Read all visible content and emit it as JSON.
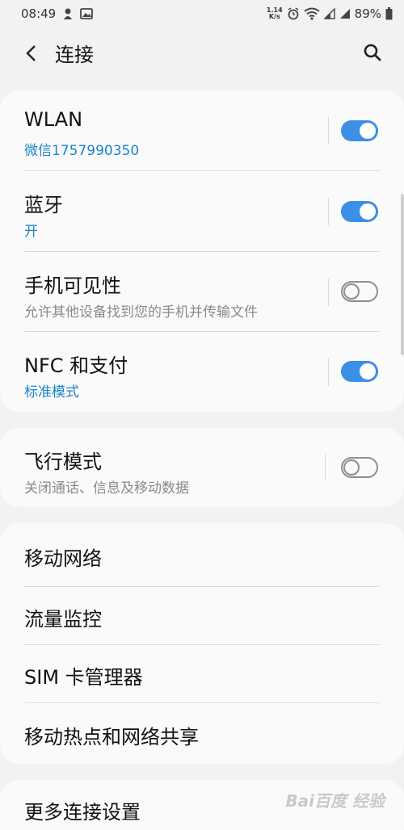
{
  "status_bar": {
    "time": "08:49",
    "net_speed_value": "1.14",
    "net_speed_unit": "K/s",
    "battery": "89%"
  },
  "header": {
    "title": "连接"
  },
  "card1": {
    "rows": [
      {
        "title": "WLAN",
        "subtitle": "微信1757990350",
        "toggle": "on"
      },
      {
        "title": "蓝牙",
        "subtitle": "开",
        "toggle": "on"
      },
      {
        "title": "手机可见性",
        "subtitle": "允许其他设备找到您的手机并传输文件",
        "toggle": "off"
      },
      {
        "title": "NFC 和支付",
        "subtitle": "标准模式",
        "toggle": "on"
      }
    ]
  },
  "card2": {
    "rows": [
      {
        "title": "飞行模式",
        "subtitle": "关闭通话、信息及移动数据",
        "toggle": "off"
      }
    ]
  },
  "card3": {
    "items": [
      "移动网络",
      "流量监控",
      "SIM 卡管理器",
      "移动热点和网络共享"
    ]
  },
  "card4": {
    "items": [
      "更多连接设置"
    ]
  },
  "watermark": "Bai百度 经验",
  "colors": {
    "accent": "#3b8fe4",
    "subtitle_blue": "#1d84c9",
    "background": "#f2f2f2",
    "card": "#fafafa"
  }
}
